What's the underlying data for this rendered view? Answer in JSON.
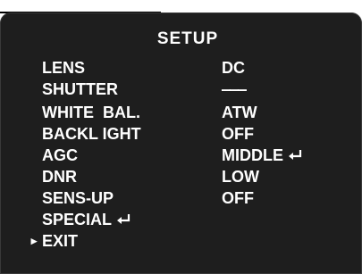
{
  "menu": {
    "title": "SETUP",
    "cursor_glyph": "▸",
    "items": [
      {
        "label": "LENS",
        "value": "DC",
        "submenu": false,
        "selected": false
      },
      {
        "label": "SHUTTER",
        "value": "‒‒‒",
        "submenu": false,
        "selected": false
      },
      {
        "label": "WHITE  BAL.",
        "value": "ATW",
        "submenu": false,
        "selected": false
      },
      {
        "label": "BACKL IGHT",
        "value": "OFF",
        "submenu": false,
        "selected": false
      },
      {
        "label": "AGC",
        "value": "MIDDLE",
        "value_submenu": true,
        "selected": false
      },
      {
        "label": "DNR",
        "value": "LOW",
        "submenu": false,
        "selected": false
      },
      {
        "label": "SENS-UP",
        "value": "OFF",
        "submenu": false,
        "selected": false
      },
      {
        "label": "SPECIAL",
        "value": "",
        "label_submenu": true,
        "selected": false
      },
      {
        "label": "EXIT",
        "value": "",
        "submenu": false,
        "selected": true
      }
    ]
  },
  "colors": {
    "osd_background": "#1e1e1e",
    "text": "#ffffff",
    "page_background": "#ffffff"
  },
  "icons": {
    "submenu": "enter-return-icon",
    "cursor": "triangle-right-icon"
  }
}
